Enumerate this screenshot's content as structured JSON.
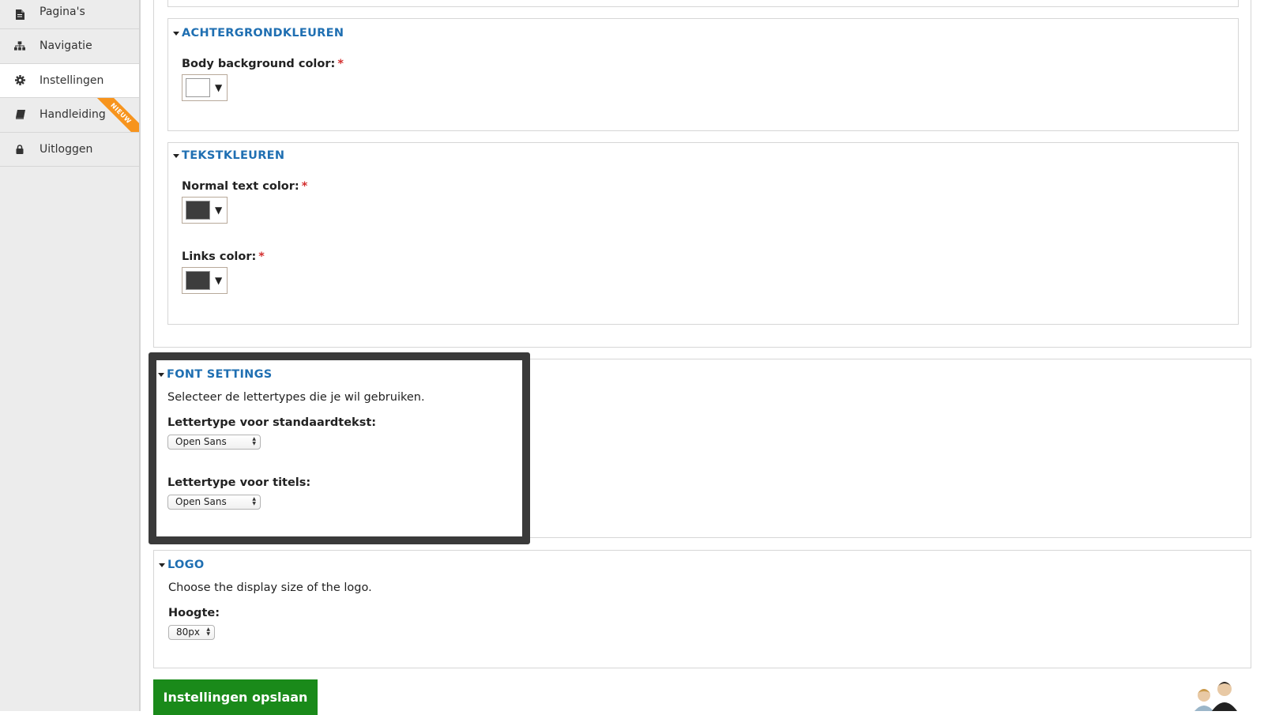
{
  "sidebar": {
    "items": [
      {
        "label": "Pagina's",
        "icon": "document-icon"
      },
      {
        "label": "Navigatie",
        "icon": "sitemap-icon"
      },
      {
        "label": "Instellingen",
        "icon": "gear-icon",
        "active": true
      },
      {
        "label": "Handleiding",
        "icon": "book-icon",
        "badge": "NIEUW"
      },
      {
        "label": "Uitloggen",
        "icon": "lock-icon"
      }
    ]
  },
  "background_colors": {
    "title": "ACHTERGRONDKLEUREN",
    "body_label": "Body background color:",
    "body_color": "#ffffff"
  },
  "text_colors": {
    "title": "TEKSTKLEUREN",
    "normal_label": "Normal text color:",
    "normal_color": "#3d3d3d",
    "links_label": "Links color:",
    "links_color": "#3d3d3d"
  },
  "required_mark": "*",
  "font_settings": {
    "title": "FONT SETTINGS",
    "description": "Selecteer de lettertypes die je wil gebruiken.",
    "standard_label": "Lettertype voor standaardtekst:",
    "standard_value": "Open Sans",
    "titles_label": "Lettertype voor titels:",
    "titles_value": "Open Sans"
  },
  "logo": {
    "title": "LOGO",
    "description": "Choose the display size of the logo.",
    "height_label": "Hoogte:",
    "height_value": "80px"
  },
  "save_label": "Instellingen opslaan",
  "colors": {
    "accent": "#1f6fb2",
    "save": "#1a8a1a",
    "badge": "#f7941d"
  }
}
